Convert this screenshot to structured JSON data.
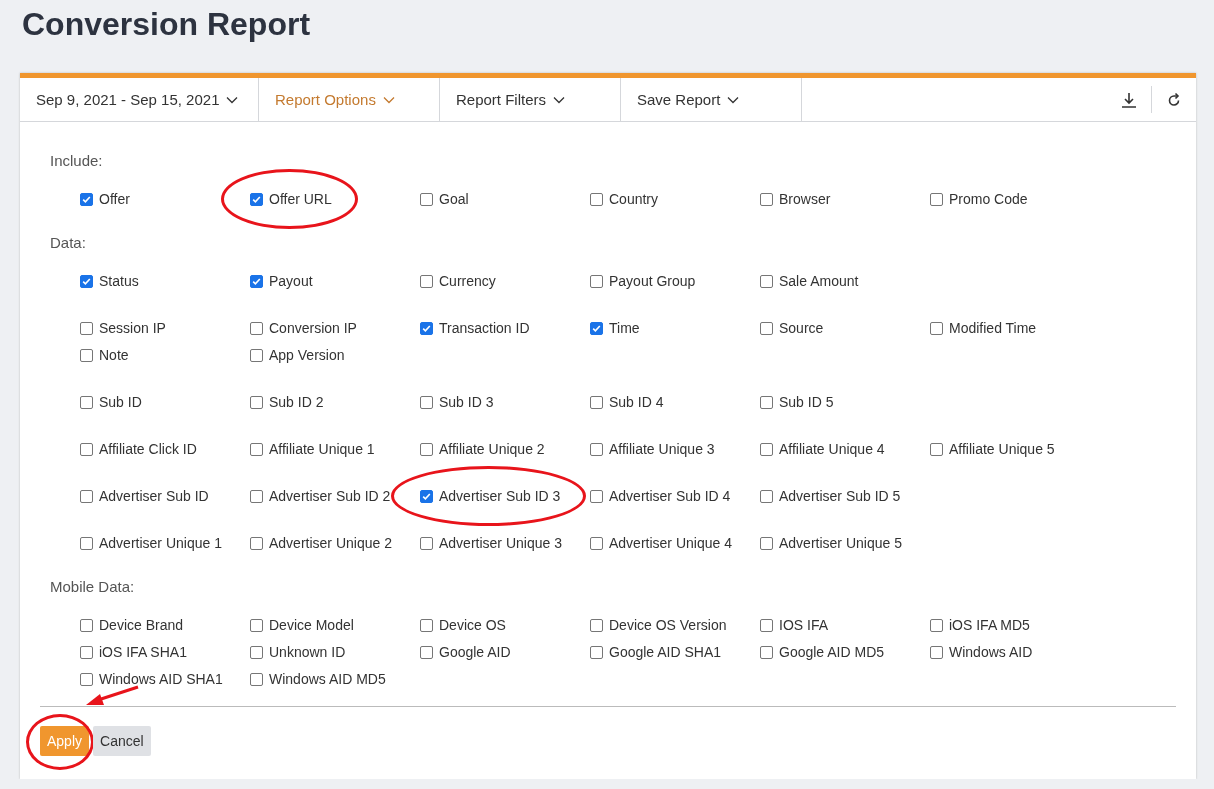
{
  "title": "Conversion Report",
  "toolbar": {
    "menus": [
      {
        "label": "Sep 9, 2021 - Sep 15, 2021",
        "selected": false
      },
      {
        "label": "Report Options",
        "selected": true
      },
      {
        "label": "Report Filters",
        "selected": false
      },
      {
        "label": "Save Report",
        "selected": false
      }
    ]
  },
  "sections": [
    {
      "label": "Include:",
      "groups": [
        [
          {
            "label": "Offer",
            "checked": true,
            "highlighted": false
          },
          {
            "label": "Offer URL",
            "checked": true,
            "highlighted": true
          },
          {
            "label": "Goal",
            "checked": false,
            "highlighted": false
          },
          {
            "label": "Country",
            "checked": false,
            "highlighted": false
          },
          {
            "label": "Browser",
            "checked": false,
            "highlighted": false
          },
          {
            "label": "Promo Code",
            "checked": false,
            "highlighted": false
          }
        ]
      ]
    },
    {
      "label": "Data:",
      "groups": [
        [
          {
            "label": "Status",
            "checked": true,
            "highlighted": false
          },
          {
            "label": "Payout",
            "checked": true,
            "highlighted": false
          },
          {
            "label": "Currency",
            "checked": false,
            "highlighted": false
          },
          {
            "label": "Payout Group",
            "checked": false,
            "highlighted": false
          },
          {
            "label": "Sale Amount",
            "checked": false,
            "highlighted": false
          }
        ],
        [
          {
            "label": "Session IP",
            "checked": false,
            "highlighted": false
          },
          {
            "label": "Conversion IP",
            "checked": false,
            "highlighted": false
          },
          {
            "label": "Transaction ID",
            "checked": true,
            "highlighted": false
          },
          {
            "label": "Time",
            "checked": true,
            "highlighted": false
          },
          {
            "label": "Source",
            "checked": false,
            "highlighted": false
          },
          {
            "label": "Modified Time",
            "checked": false,
            "highlighted": false
          },
          {
            "label": "Note",
            "checked": false,
            "highlighted": false
          },
          {
            "label": "App Version",
            "checked": false,
            "highlighted": false
          }
        ],
        [
          {
            "label": "Sub ID",
            "checked": false,
            "highlighted": false
          },
          {
            "label": "Sub ID 2",
            "checked": false,
            "highlighted": false
          },
          {
            "label": "Sub ID 3",
            "checked": false,
            "highlighted": false
          },
          {
            "label": "Sub ID 4",
            "checked": false,
            "highlighted": false
          },
          {
            "label": "Sub ID 5",
            "checked": false,
            "highlighted": false
          }
        ],
        [
          {
            "label": "Affiliate Click ID",
            "checked": false,
            "highlighted": false
          },
          {
            "label": "Affiliate Unique 1",
            "checked": false,
            "highlighted": false
          },
          {
            "label": "Affiliate Unique 2",
            "checked": false,
            "highlighted": false
          },
          {
            "label": "Affiliate Unique 3",
            "checked": false,
            "highlighted": false
          },
          {
            "label": "Affiliate Unique 4",
            "checked": false,
            "highlighted": false
          },
          {
            "label": "Affiliate Unique 5",
            "checked": false,
            "highlighted": false
          }
        ],
        [
          {
            "label": "Advertiser Sub ID",
            "checked": false,
            "highlighted": false
          },
          {
            "label": "Advertiser Sub ID 2",
            "checked": false,
            "highlighted": false
          },
          {
            "label": "Advertiser Sub ID 3",
            "checked": true,
            "highlighted": true
          },
          {
            "label": "Advertiser Sub ID 4",
            "checked": false,
            "highlighted": false
          },
          {
            "label": "Advertiser Sub ID 5",
            "checked": false,
            "highlighted": false
          }
        ],
        [
          {
            "label": "Advertiser Unique 1",
            "checked": false,
            "highlighted": false
          },
          {
            "label": "Advertiser Unique 2",
            "checked": false,
            "highlighted": false
          },
          {
            "label": "Advertiser Unique 3",
            "checked": false,
            "highlighted": false
          },
          {
            "label": "Advertiser Unique 4",
            "checked": false,
            "highlighted": false
          },
          {
            "label": "Advertiser Unique 5",
            "checked": false,
            "highlighted": false
          }
        ]
      ]
    },
    {
      "label": "Mobile Data:",
      "groups": [
        [
          {
            "label": "Device Brand",
            "checked": false,
            "highlighted": false
          },
          {
            "label": "Device Model",
            "checked": false,
            "highlighted": false
          },
          {
            "label": "Device OS",
            "checked": false,
            "highlighted": false
          },
          {
            "label": "Device OS Version",
            "checked": false,
            "highlighted": false
          },
          {
            "label": "IOS IFA",
            "checked": false,
            "highlighted": false
          },
          {
            "label": "iOS IFA MD5",
            "checked": false,
            "highlighted": false
          },
          {
            "label": "iOS IFA SHA1",
            "checked": false,
            "highlighted": false
          },
          {
            "label": "Unknown ID",
            "checked": false,
            "highlighted": false
          },
          {
            "label": "Google AID",
            "checked": false,
            "highlighted": false
          },
          {
            "label": "Google AID SHA1",
            "checked": false,
            "highlighted": false
          },
          {
            "label": "Google AID MD5",
            "checked": false,
            "highlighted": false
          },
          {
            "label": "Windows AID",
            "checked": false,
            "highlighted": false
          },
          {
            "label": "Windows AID SHA1",
            "checked": false,
            "highlighted": false
          },
          {
            "label": "Windows AID MD5",
            "checked": false,
            "highlighted": false
          }
        ]
      ]
    }
  ],
  "buttons": [
    {
      "label": "Apply",
      "kind": "primary",
      "highlighted": true
    },
    {
      "label": "Cancel",
      "kind": "secondary",
      "highlighted": false
    }
  ]
}
